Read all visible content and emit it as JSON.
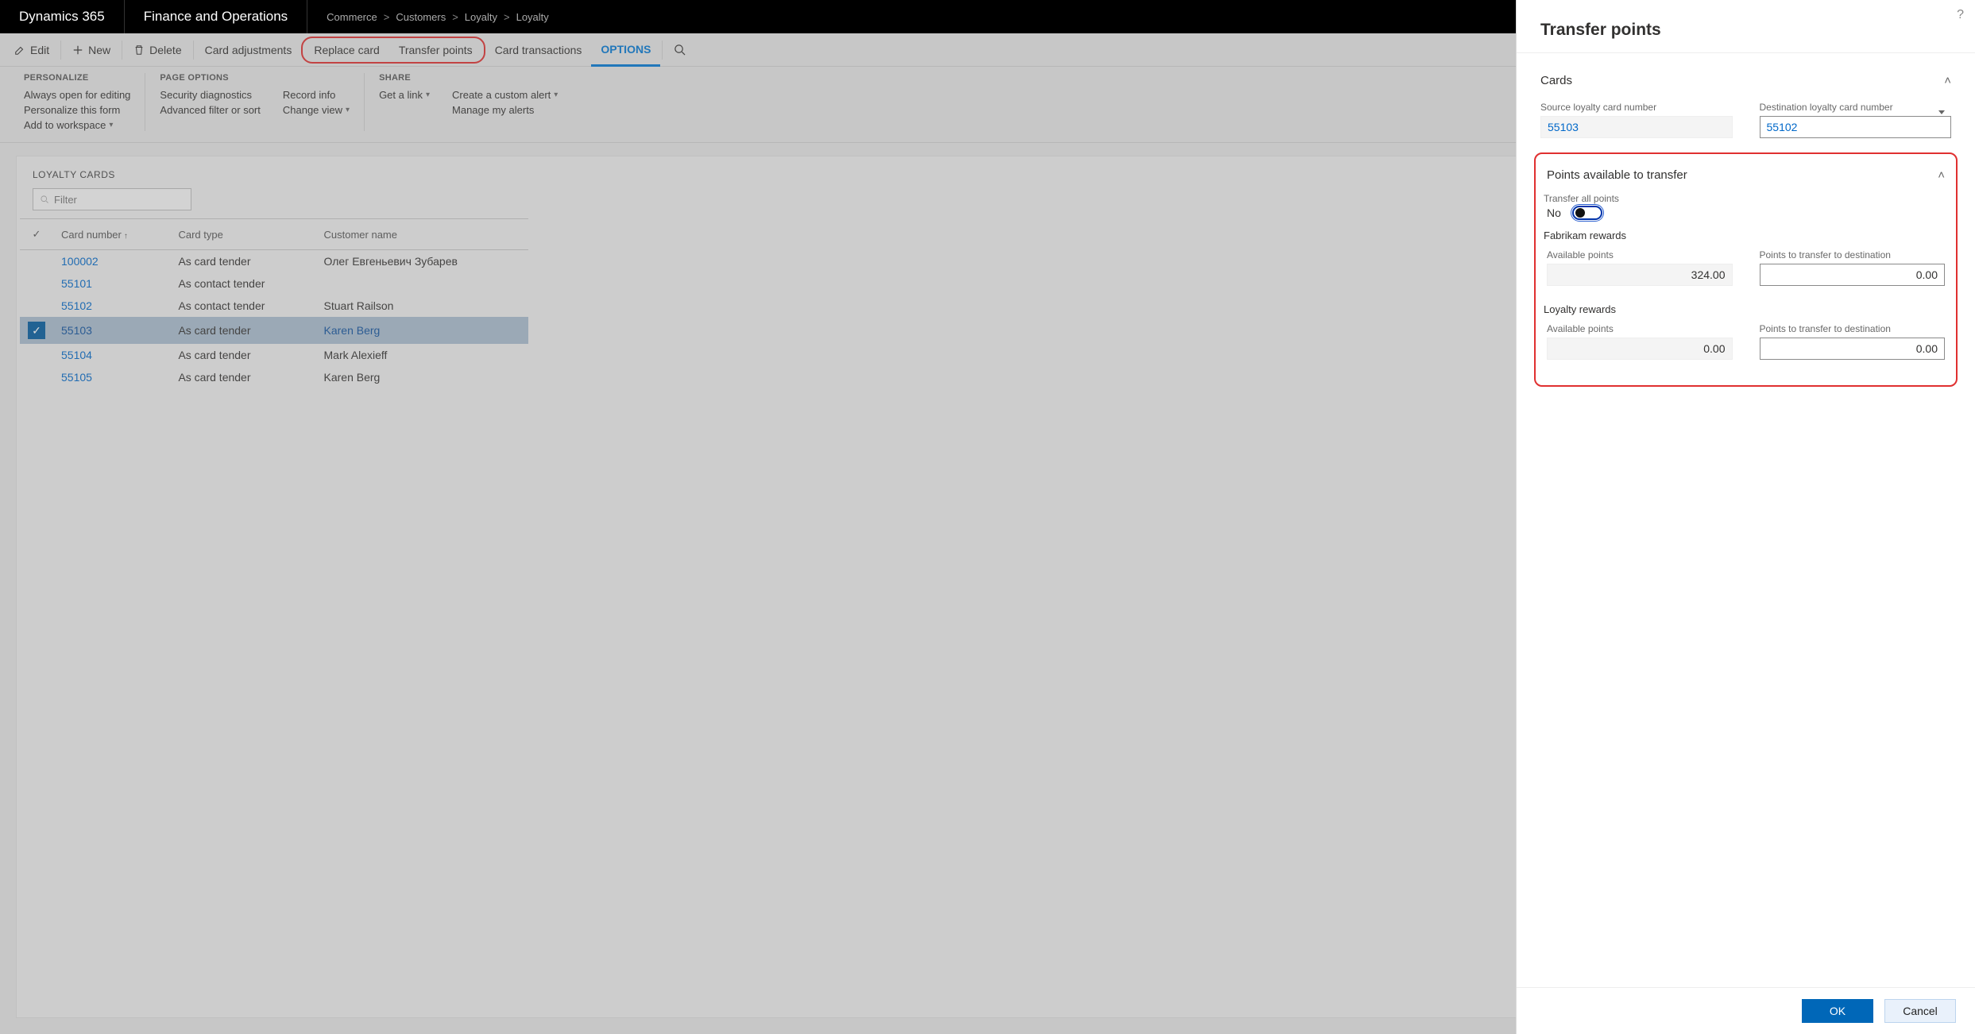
{
  "header": {
    "brand": "Dynamics 365",
    "product": "Finance and Operations",
    "breadcrumb": [
      "Commerce",
      "Customers",
      "Loyalty",
      "Loyalty"
    ]
  },
  "actions": {
    "edit": "Edit",
    "new": "New",
    "delete": "Delete",
    "card_adjustments": "Card adjustments",
    "replace_card": "Replace card",
    "transfer_points": "Transfer points",
    "card_transactions": "Card transactions",
    "options": "OPTIONS"
  },
  "ribbon": {
    "personalize": {
      "title": "PERSONALIZE",
      "items": [
        "Always open for editing",
        "Personalize this form",
        "Add to workspace"
      ]
    },
    "page_options": {
      "title": "PAGE OPTIONS",
      "col1": [
        "Security diagnostics",
        "Advanced filter or sort"
      ],
      "col2": [
        "Record info",
        "Change view"
      ]
    },
    "share": {
      "title": "SHARE",
      "col1": [
        "Get a link"
      ],
      "col2": [
        "Create a custom alert",
        "Manage my alerts"
      ]
    }
  },
  "list": {
    "title": "LOYALTY CARDS",
    "filter_placeholder": "Filter",
    "columns": {
      "card_number": "Card number",
      "card_type": "Card type",
      "customer_name": "Customer name"
    },
    "rows": [
      {
        "card_number": "100002",
        "card_type": "As card tender",
        "customer_name": "Олег Евгеньевич Зубарев",
        "selected": false
      },
      {
        "card_number": "55101",
        "card_type": "As contact tender",
        "customer_name": "",
        "selected": false
      },
      {
        "card_number": "55102",
        "card_type": "As contact tender",
        "customer_name": "Stuart Railson",
        "selected": false
      },
      {
        "card_number": "55103",
        "card_type": "As card tender",
        "customer_name": "Karen Berg",
        "selected": true
      },
      {
        "card_number": "55104",
        "card_type": "As card tender",
        "customer_name": "Mark Alexieff",
        "selected": false
      },
      {
        "card_number": "55105",
        "card_type": "As card tender",
        "customer_name": "Karen Berg",
        "selected": false
      }
    ]
  },
  "panel": {
    "title": "Transfer points",
    "help": "?",
    "cards_section": "Cards",
    "source_label": "Source loyalty card number",
    "source_value": "55103",
    "dest_label": "Destination loyalty card number",
    "dest_value": "55102",
    "points_section": "Points available to transfer",
    "transfer_all_label": "Transfer all points",
    "transfer_all_value": "No",
    "groups": [
      {
        "name": "Fabrikam rewards",
        "available_label": "Available points",
        "available_value": "324.00",
        "to_transfer_label": "Points to transfer to destination",
        "to_transfer_value": "0.00"
      },
      {
        "name": "Loyalty rewards",
        "available_label": "Available points",
        "available_value": "0.00",
        "to_transfer_label": "Points to transfer to destination",
        "to_transfer_value": "0.00"
      }
    ],
    "ok": "OK",
    "cancel": "Cancel"
  }
}
